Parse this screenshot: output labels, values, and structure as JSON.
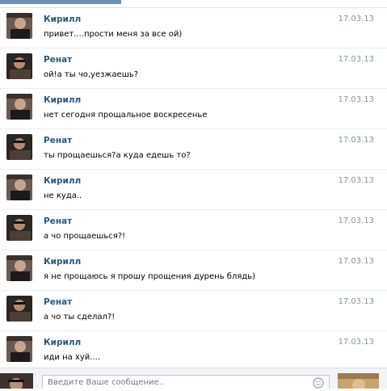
{
  "messages": [
    {
      "author": "Кирилл",
      "date": "17.03.13",
      "text": "привет....прости меня за все ой)"
    },
    {
      "author": "Ренат",
      "date": "17.03.13",
      "text": "ой!а ты чо,уезжаешь?"
    },
    {
      "author": "Кирилл",
      "date": "17.03.13",
      "text": "нет сегодня прощальное воскресенье"
    },
    {
      "author": "Ренат",
      "date": "17.03.13",
      "text": "ты прощаешься?а куда едешь то?"
    },
    {
      "author": "Кирилл",
      "date": "17.03.13",
      "text": "не куда.."
    },
    {
      "author": "Ренат",
      "date": "17.03.13",
      "text": "а чо прощаешься?!"
    },
    {
      "author": "Кирилл",
      "date": "17.03.13",
      "text": "я не прощаюсь я прошу прощения дурень блядь)"
    },
    {
      "author": "Ренат",
      "date": "17.03.13",
      "text": "а чо ты сделал?!"
    },
    {
      "author": "Кирилл",
      "date": "17.03.13",
      "text": "иди на хуй...."
    }
  ],
  "composer": {
    "placeholder": "Введите Ваше сообщение.."
  },
  "colors": {
    "author_link": "#2b587a",
    "date": "#8a939b",
    "accent": "#6d8fb3"
  },
  "icons": {
    "smile": "smile-icon"
  }
}
